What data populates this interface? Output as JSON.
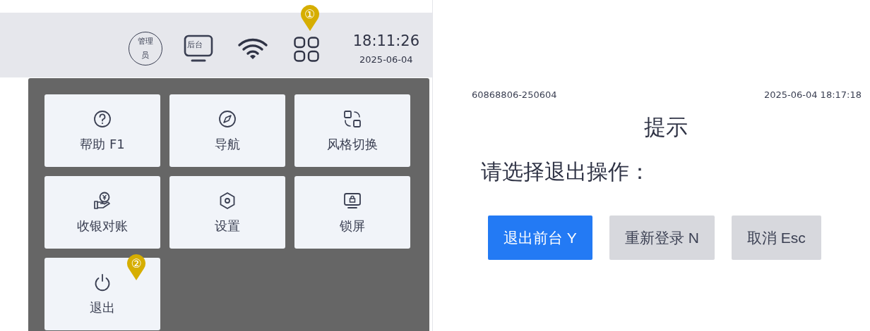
{
  "top_bar": {
    "user_badge": "管理员",
    "backend_label": "后台",
    "apps_marker": "①",
    "time": "18:11:26",
    "date": "2025-06-04"
  },
  "menu": {
    "tiles": [
      {
        "label": "帮助 F1"
      },
      {
        "label": "导航"
      },
      {
        "label": "风格切换"
      },
      {
        "label": "收银对账"
      },
      {
        "label": "设置"
      },
      {
        "label": "锁屏"
      },
      {
        "label": "退出",
        "marker": "②"
      }
    ]
  },
  "dialog": {
    "order_no": "60868806-250604",
    "timestamp": "2025-06-04 18:17:18",
    "title": "提示",
    "message": "请选择退出操作：",
    "buttons": [
      {
        "label": "退出前台 Y",
        "primary": true
      },
      {
        "label": "重新登录 N",
        "primary": false
      },
      {
        "label": "取消 Esc",
        "primary": false
      }
    ]
  }
}
